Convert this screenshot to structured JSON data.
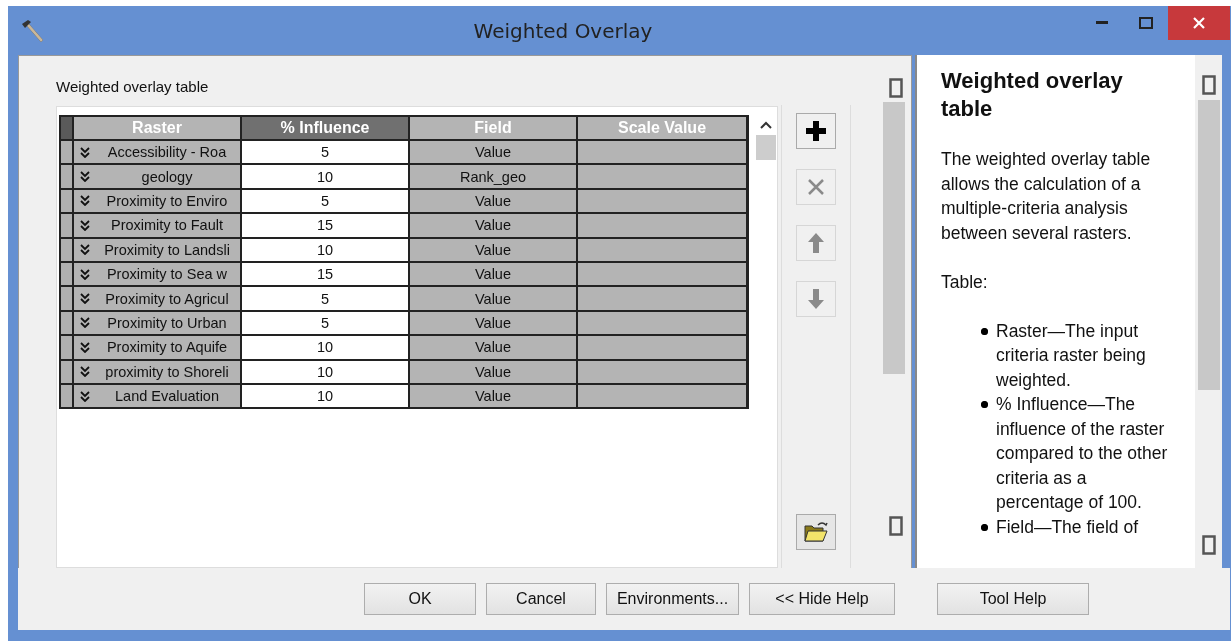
{
  "window": {
    "title": "Weighted Overlay"
  },
  "table": {
    "label": "Weighted overlay table",
    "columns": [
      "Raster",
      "% Influence",
      "Field",
      "Scale Value"
    ],
    "rows": [
      {
        "raster": "Accessibility - Roa",
        "influence": "5",
        "field": "Value"
      },
      {
        "raster": "geology",
        "influence": "10",
        "field": "Rank_geo"
      },
      {
        "raster": "Proximity to Enviro",
        "influence": "5",
        "field": "Value"
      },
      {
        "raster": "Proximity to Fault",
        "influence": "15",
        "field": "Value"
      },
      {
        "raster": "Proximity to Landsli",
        "influence": "10",
        "field": "Value"
      },
      {
        "raster": "Proximity to Sea w",
        "influence": "15",
        "field": "Value"
      },
      {
        "raster": "Proximity to Agricul",
        "influence": "5",
        "field": "Value"
      },
      {
        "raster": "Proximity to Urban",
        "influence": "5",
        "field": "Value"
      },
      {
        "raster": "Proximity to Aquife",
        "influence": "10",
        "field": "Value"
      },
      {
        "raster": "proximity to Shoreli",
        "influence": "10",
        "field": "Value"
      },
      {
        "raster": "Land Evaluation",
        "influence": "10",
        "field": "Value"
      }
    ]
  },
  "tools": [
    {
      "kind": "add",
      "disabled": false
    },
    {
      "kind": "remove",
      "disabled": true
    },
    {
      "kind": "up",
      "disabled": true
    },
    {
      "kind": "down",
      "disabled": true
    }
  ],
  "help": {
    "title": "Weighted overlay table",
    "paragraphs": [
      "The weighted overlay table allows the calculation of a multiple-criteria analysis between several rasters.",
      "Table:"
    ],
    "bullets": [
      "Raster—The input criteria raster being weighted.",
      "% Influence—The influence of the raster compared to the other criteria as a percentage of 100.",
      "Field—The field of"
    ]
  },
  "buttons": [
    "OK",
    "Cancel",
    "Environments...",
    "<< Hide Help",
    "Tool Help"
  ]
}
